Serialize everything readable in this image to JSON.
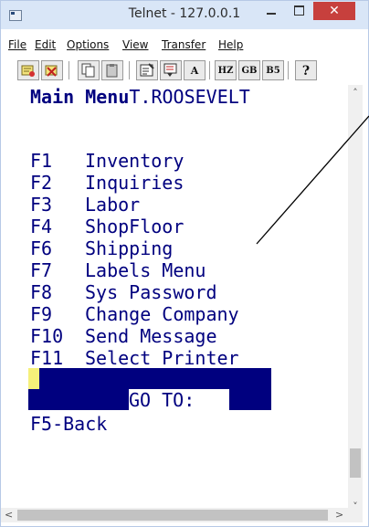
{
  "window": {
    "title": "Telnet - 127.0.0.1"
  },
  "title_buttons": {
    "minimize": "−",
    "maximize": "□",
    "close": "✕"
  },
  "menu": [
    {
      "label": "File"
    },
    {
      "label": "Edit"
    },
    {
      "label": "Options"
    },
    {
      "label": "View"
    },
    {
      "label": "Transfer"
    },
    {
      "label": "Help"
    }
  ],
  "toolbar": {
    "connect_icon": "connect-icon",
    "disconnect_icon": "disconnect-icon",
    "copy_icon": "copy-icon",
    "paste_icon": "paste-icon",
    "properties_icon": "properties-icon",
    "font_icon": "font-icon",
    "font_label": "A",
    "hz_label": "HZ",
    "gb_label": "GB",
    "b5_label": "B5",
    "help_label": "?"
  },
  "terminal": {
    "header_title": "Main Menu",
    "header_user": "T.ROOSEVELT",
    "menu_items": [
      {
        "key": "F1",
        "label": "Inventory"
      },
      {
        "key": "F2",
        "label": "Inquiries"
      },
      {
        "key": "F3",
        "label": "Labor"
      },
      {
        "key": "F4",
        "label": "ShopFloor"
      },
      {
        "key": "F6",
        "label": "Shipping"
      },
      {
        "key": "F7",
        "label": "Labels Menu"
      },
      {
        "key": "F8",
        "label": "Sys Password"
      },
      {
        "key": "F9",
        "label": "Change Company"
      },
      {
        "key": "F10",
        "label": "Send Message"
      },
      {
        "key": "F11",
        "label": "Select Printer"
      }
    ],
    "goto_label": "GO TO:",
    "back_label": "F5-Back"
  },
  "colors": {
    "terminal_text": "#00007f",
    "terminal_bg": "#ffffff",
    "cursor": "#f5f07a",
    "close_button": "#c7403d",
    "titlebar": "#d9e6f7"
  }
}
